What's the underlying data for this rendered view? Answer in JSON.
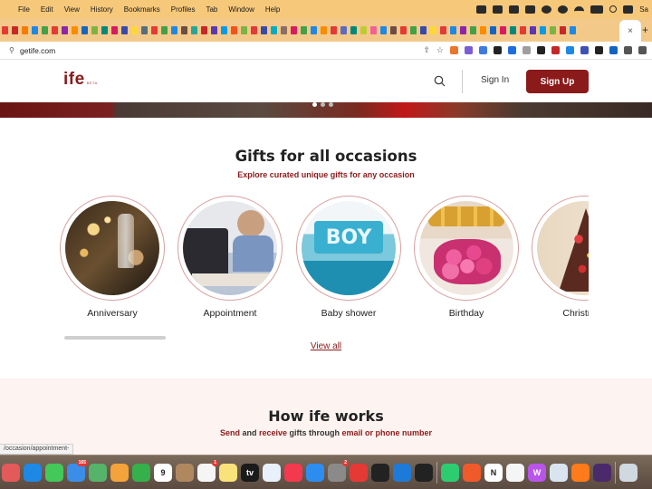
{
  "menubar": {
    "items": [
      "File",
      "Edit",
      "View",
      "History",
      "Bookmarks",
      "Profiles",
      "Tab",
      "Window",
      "Help"
    ],
    "clock": "Sa"
  },
  "browser": {
    "url": "getife.com",
    "tab_close": "×",
    "new_tab": "+",
    "tab_favicon_colors": [
      "#e53935",
      "#c62828",
      "#f57c00",
      "#1e88e5",
      "#43a047",
      "#e53935",
      "#8e24aa",
      "#fb8c00",
      "#1565c0",
      "#7cb342",
      "#00897b",
      "#d81b60",
      "#3949ab",
      "#fdd835",
      "#546e7a",
      "#e53935",
      "#43a047",
      "#1e88e5",
      "#6d4c41",
      "#26a69a",
      "#c62828",
      "#5e35b1",
      "#039be5",
      "#f4511e",
      "#7cb342",
      "#e53935",
      "#3949ab",
      "#00acc1",
      "#8d6e63",
      "#d81b60",
      "#43a047",
      "#1e88e5",
      "#fb8c00",
      "#e53935",
      "#5c6bc0",
      "#00897b",
      "#c0ca33",
      "#f06292",
      "#1e88e5",
      "#6d4c41",
      "#e53935",
      "#43a047",
      "#3949ab",
      "#fdd835",
      "#e53935",
      "#1e88e5",
      "#8e24aa",
      "#43a047",
      "#fb8c00",
      "#1565c0",
      "#d81b60",
      "#00897b",
      "#e53935",
      "#5e35b1",
      "#039be5",
      "#7cb342",
      "#c62828",
      "#1e88e5"
    ],
    "extension_colors": [
      "#e8762c",
      "#7b5cd6",
      "#3d7be0",
      "#222222",
      "#1e6de0",
      "#9e9e9e",
      "#222222",
      "#c62828",
      "#1e88e5",
      "#3f51b5",
      "#222222",
      "#1565c0",
      "#555555",
      "#555555"
    ]
  },
  "site": {
    "logo": "ife",
    "logo_tag": "BETA",
    "sign_in": "Sign In",
    "sign_up": "Sign Up"
  },
  "occasions": {
    "title": "Gifts for all occasions",
    "subtitle": "Explore curated unique gifts for any occasion",
    "items": [
      {
        "label": "Anniversary",
        "icon": "champagne-photo"
      },
      {
        "label": "Appointment",
        "icon": "meeting-photo"
      },
      {
        "label": "Baby shower",
        "icon": "baby-shower-photo"
      },
      {
        "label": "Birthday",
        "icon": "birthday-photo"
      },
      {
        "label": "Christmas",
        "icon": "christmas-tree-photo"
      }
    ],
    "view_all": "View all"
  },
  "how": {
    "title": "How ife works",
    "send": "Send",
    "and": " and ",
    "receive": "receive",
    "through": " gifts through ",
    "channels": "email or phone number"
  },
  "status_url": "/occasion/appointment-",
  "dock": {
    "apps": [
      {
        "name": "launchpad",
        "color": "#e35a5a"
      },
      {
        "name": "safari",
        "color": "#1e88e5"
      },
      {
        "name": "messages",
        "color": "#43c85a"
      },
      {
        "name": "mail",
        "color": "#3b8ee8",
        "badge": "165"
      },
      {
        "name": "maps",
        "color": "#56b36a"
      },
      {
        "name": "photos",
        "color": "#f4a23a"
      },
      {
        "name": "facetime",
        "color": "#35b04a"
      },
      {
        "name": "calendar",
        "color": "#ffffff",
        "text": "9"
      },
      {
        "name": "contacts",
        "color": "#b08860"
      },
      {
        "name": "reminders",
        "color": "#f5f5f5",
        "badge": "1"
      },
      {
        "name": "notes",
        "color": "#f9e27a"
      },
      {
        "name": "apple-tv",
        "color": "#1a1a1a",
        "text": "tv"
      },
      {
        "name": "freeform",
        "color": "#e8f0fb"
      },
      {
        "name": "music",
        "color": "#f2394d"
      },
      {
        "name": "app-store",
        "color": "#2d8cf0"
      },
      {
        "name": "system-settings",
        "color": "#8a8a8a",
        "badge": "2"
      },
      {
        "name": "chrome",
        "color": "#e53935"
      },
      {
        "name": "terminal",
        "color": "#222222"
      },
      {
        "name": "vscode",
        "color": "#1e7ad8"
      },
      {
        "name": "figma",
        "color": "#222222"
      },
      {
        "name": "whatsapp",
        "color": "#2ecc71"
      },
      {
        "name": "brave",
        "color": "#f05a2a"
      },
      {
        "name": "notion",
        "color": "#ffffff",
        "text": "N"
      },
      {
        "name": "textedit",
        "color": "#f5f5f5"
      },
      {
        "name": "wps",
        "color": "#b855e8",
        "text": "W"
      },
      {
        "name": "preview",
        "color": "#d9e4f0"
      },
      {
        "name": "firefox",
        "color": "#ff7a1a"
      },
      {
        "name": "colors-app",
        "color": "#4a2a6a"
      },
      {
        "name": "finder",
        "color": "#d0d8e0"
      }
    ]
  }
}
